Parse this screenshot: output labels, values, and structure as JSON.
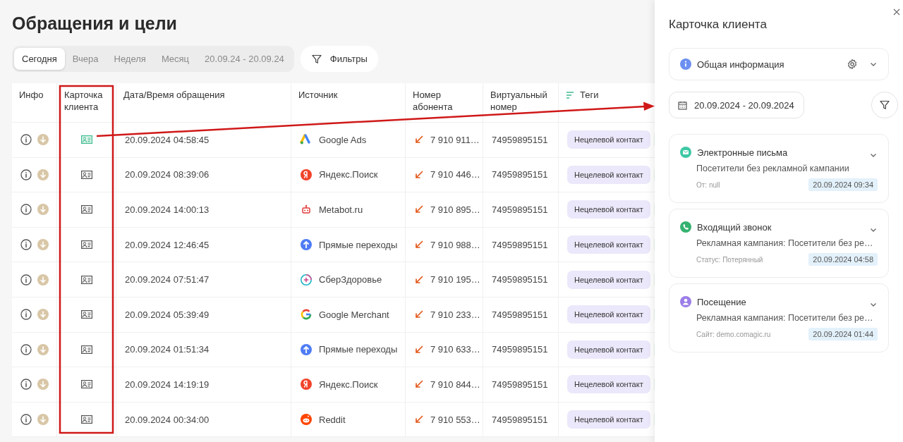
{
  "page": {
    "title": "Обращения и цели"
  },
  "period_tabs": [
    {
      "label": "Сегодня",
      "selected": true
    },
    {
      "label": "Вчера",
      "selected": false
    },
    {
      "label": "Неделя",
      "selected": false
    },
    {
      "label": "Месяц",
      "selected": false
    },
    {
      "label": "20.09.24 - 20.09.24",
      "selected": false
    }
  ],
  "filters_button": {
    "label": "Фильтры"
  },
  "table": {
    "columns": [
      "Инфо",
      "Карточка клиента",
      "Дата/Время обращения",
      "Источник",
      "Номер абонента",
      "Виртуальный номер",
      "Теги"
    ],
    "rows": [
      {
        "card_active": true,
        "datetime": "20.09.2024 04:58:45",
        "source": "Google Ads",
        "kind": "google-ads",
        "phone": "7 910 911…",
        "virtual_number": "74959895151",
        "tag": "Нецелевой контакт"
      },
      {
        "card_active": false,
        "datetime": "20.09.2024 08:39:06",
        "source": "Яндекс.Поиск",
        "kind": "yandex",
        "phone": "7 910 446…",
        "virtual_number": "74959895151",
        "tag": "Нецелевой контакт"
      },
      {
        "card_active": false,
        "datetime": "20.09.2024 14:00:13",
        "source": "Metabot.ru",
        "kind": "metabot",
        "phone": "7 910 895…",
        "virtual_number": "74959895151",
        "tag": "Нецелевой контакт"
      },
      {
        "card_active": false,
        "datetime": "20.09.2024 12:46:45",
        "source": "Прямые переходы",
        "kind": "direct",
        "phone": "7 910 988…",
        "virtual_number": "74959895151",
        "tag": "Нецелевой контакт"
      },
      {
        "card_active": false,
        "datetime": "20.09.2024 07:51:47",
        "source": "СберЗдоровье",
        "kind": "sber",
        "phone": "7 910 195…",
        "virtual_number": "74959895151",
        "tag": "Нецелевой контакт"
      },
      {
        "card_active": false,
        "datetime": "20.09.2024 05:39:49",
        "source": "Google Merchant",
        "kind": "google",
        "phone": "7 910 233…",
        "virtual_number": "74959895151",
        "tag": "Нецелевой контакт"
      },
      {
        "card_active": false,
        "datetime": "20.09.2024 01:51:34",
        "source": "Прямые переходы",
        "kind": "direct",
        "phone": "7 910 633…",
        "virtual_number": "74959895151",
        "tag": "Нецелевой контакт"
      },
      {
        "card_active": false,
        "datetime": "20.09.2024 14:19:19",
        "source": "Яндекс.Поиск",
        "kind": "yandex",
        "phone": "7 910 844…",
        "virtual_number": "74959895151",
        "tag": "Нецелевой контакт"
      },
      {
        "card_active": false,
        "datetime": "20.09.2024 00:34:00",
        "source": "Reddit",
        "kind": "reddit",
        "phone": "7 910 553…",
        "virtual_number": "74959895151",
        "tag": "Нецелевой контакт"
      }
    ]
  },
  "client_card": {
    "title": "Карточка клиента",
    "general_section": {
      "label": "Общая информация",
      "expanded": false
    },
    "date_range": "20.09.2024 - 20.09.2024",
    "events": [
      {
        "kind": "email",
        "title": "Электронные письма",
        "description": "Посетители без рекламной кампании",
        "meta": "От: null",
        "date": "20.09.2024 09:34"
      },
      {
        "kind": "call",
        "title": "Входящий звонок",
        "description": "Рекламная кампания: Посетители без ре…",
        "meta": "Статус: Потерянный",
        "date": "20.09.2024 04:58"
      },
      {
        "kind": "visit",
        "title": "Посещение",
        "description": "Рекламная кампания: Посетители без ре…",
        "meta": "Сайт: demo.comagic.ru",
        "date": "20.09.2024 01:44"
      }
    ]
  }
}
